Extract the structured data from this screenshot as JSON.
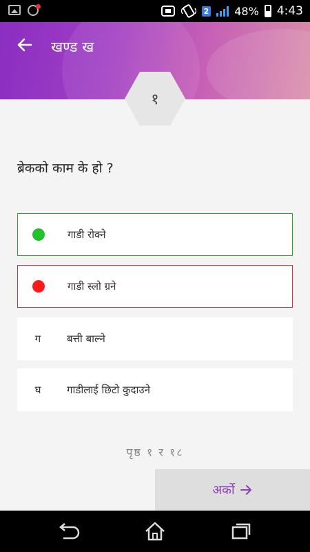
{
  "status_bar": {
    "battery": "48%",
    "sim_badge": "2",
    "time": "4:43",
    "icons": [
      "gallery-icon",
      "notification-icon",
      "nfc-icon",
      "vibrate-icon",
      "signal-icon",
      "battery-icon"
    ]
  },
  "header": {
    "title": "खण्ड ख",
    "back_icon": "arrow-left-icon"
  },
  "question": {
    "number": "१",
    "text": "ब्रेकको काम के हो ?"
  },
  "options": [
    {
      "marker": "",
      "label": "गाडी रोक्ने",
      "state": "correct",
      "color": "#22c32a"
    },
    {
      "marker": "",
      "label": "गाडी स्लो ग्रने",
      "state": "wrong",
      "color": "#ff1a1a"
    },
    {
      "marker": "ग",
      "label": "बत्ती बाल्ने",
      "state": "neutral"
    },
    {
      "marker": "घ",
      "label": "गाडीलाई छिटो कुदाउने",
      "state": "neutral"
    }
  ],
  "pagination": {
    "prefix": "पृष्ठ",
    "current": "१",
    "separator": "र",
    "total": "१८"
  },
  "next_button": {
    "label": "अर्को",
    "icon": "arrow-right-icon"
  },
  "nav_bar": {
    "icons": [
      "back-icon",
      "home-icon",
      "recent-apps-icon"
    ]
  }
}
